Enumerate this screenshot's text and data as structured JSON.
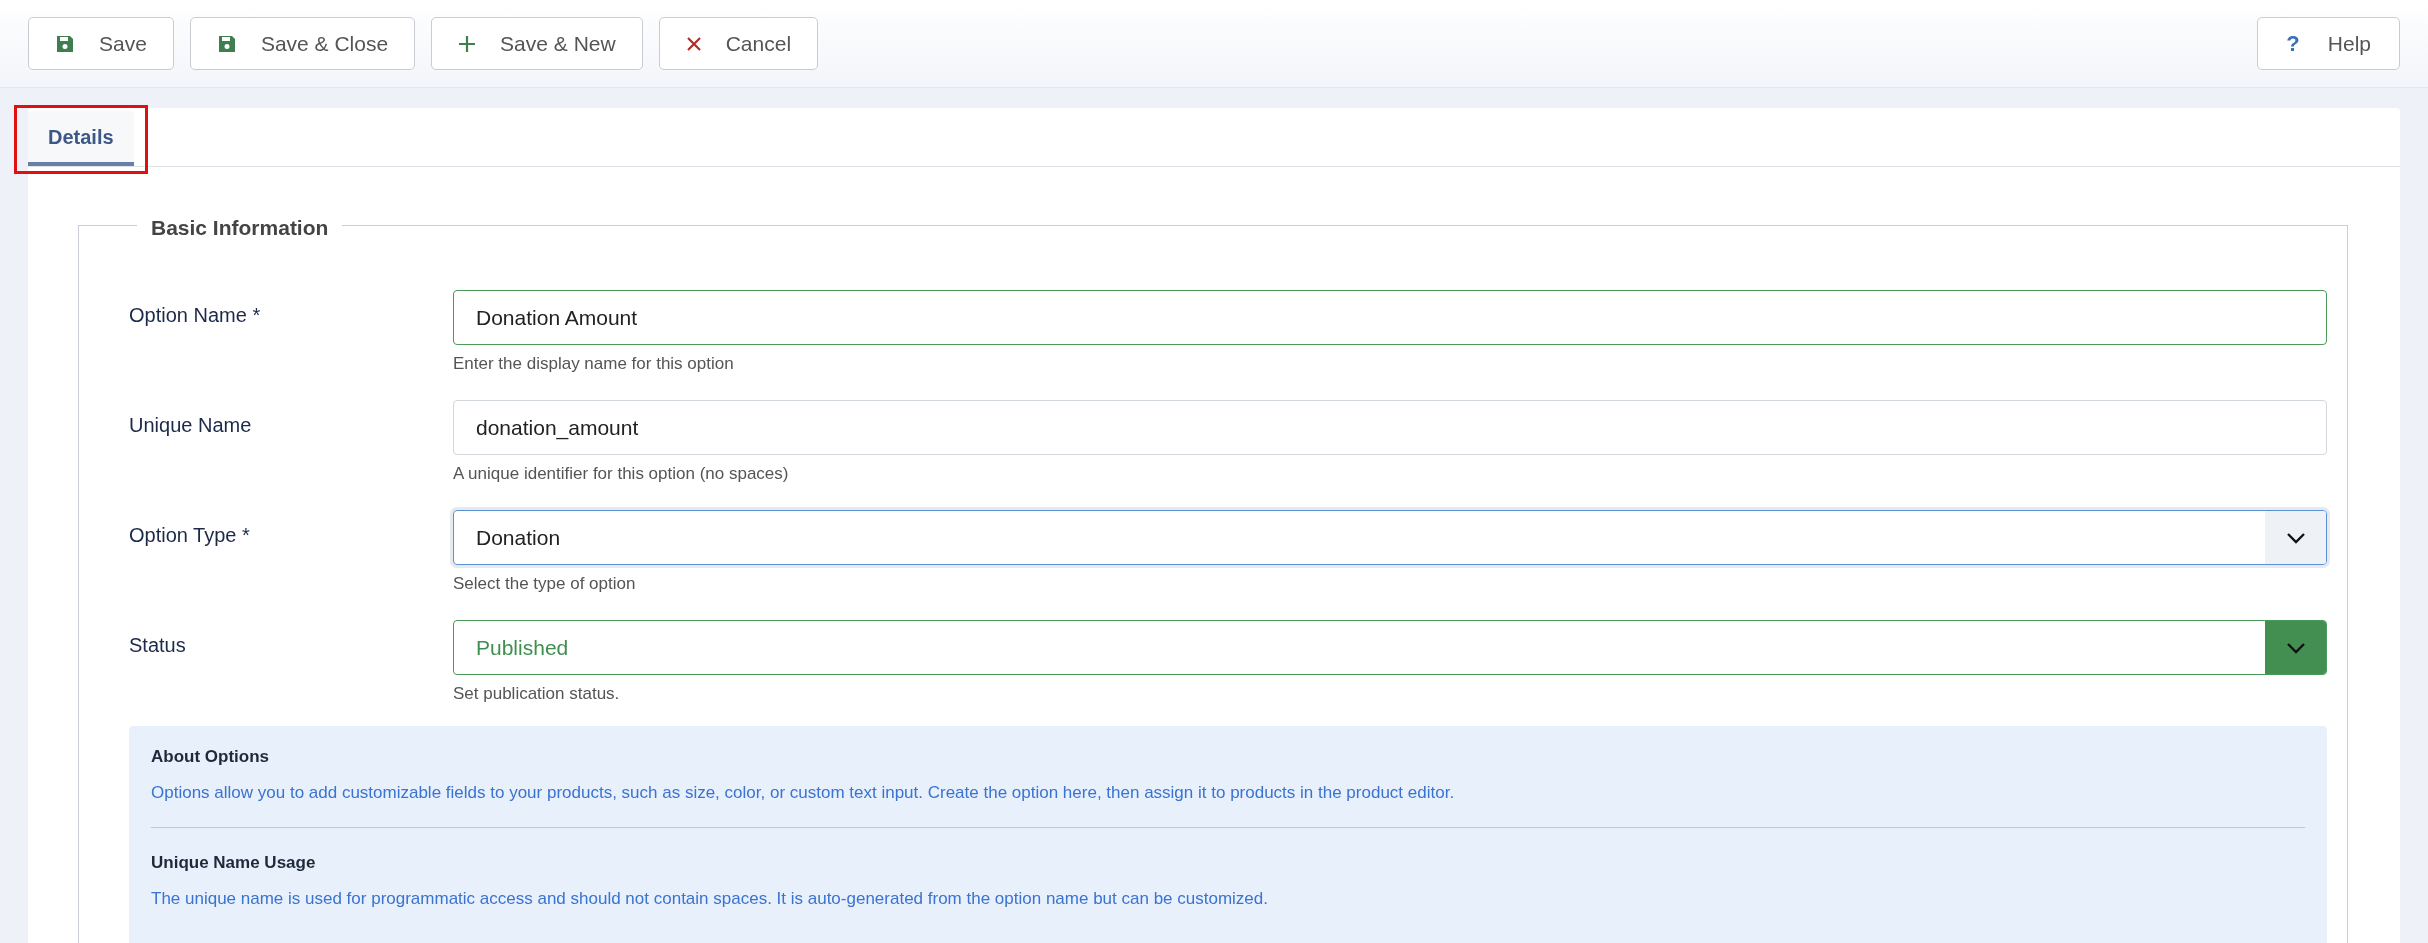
{
  "toolbar": {
    "buttons": [
      {
        "label": "Save",
        "kind": "save"
      },
      {
        "label": "Save & Close",
        "kind": "save"
      },
      {
        "label": "Save & New",
        "kind": "new"
      },
      {
        "label": "Cancel",
        "kind": "cancel"
      }
    ],
    "help": {
      "label": "Help",
      "icon": "?"
    }
  },
  "tabs": [
    {
      "label": "Details",
      "selected": true,
      "highlighted": true
    }
  ],
  "fieldset": {
    "legend": "Basic Information",
    "fields": [
      {
        "label": "Option Name *",
        "kind": "text",
        "value": "Donation Amount",
        "hint": "Enter the display name for this option",
        "valid": true,
        "focused": false
      },
      {
        "label": "Unique Name",
        "kind": "text",
        "value": "donation_amount",
        "hint": "A unique identifier for this option (no spaces)",
        "valid": false,
        "focused": false
      },
      {
        "label": "Option Type *",
        "kind": "select",
        "value": "Donation",
        "hint": "Select the type of option",
        "valid": false,
        "focused": true
      },
      {
        "label": "Status",
        "kind": "select",
        "value": "Published",
        "hint": "Set publication status.",
        "valid": true,
        "focused": false
      }
    ],
    "info": [
      {
        "title": "About Options",
        "text": "Options allow you to add customizable fields to your products, such as size, color, or custom text input. Create the option here, then assign it to products in the product editor."
      },
      {
        "title": "Unique Name Usage",
        "text": "The unique name is used for programmatic access and should not contain spaces. It is auto-generated from the option name but can be customized."
      }
    ]
  }
}
